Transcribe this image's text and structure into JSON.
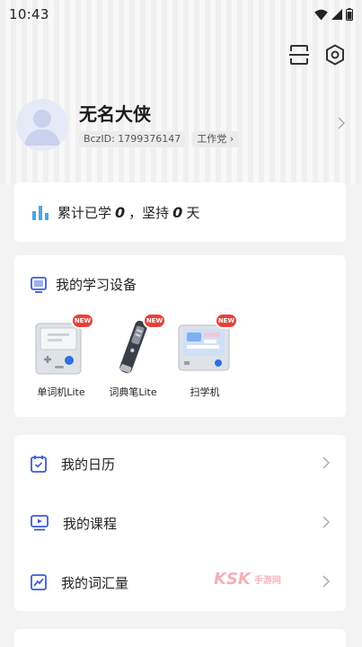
{
  "status_bar": {
    "time": "10:43"
  },
  "profile": {
    "name": "无名大侠",
    "bczid": "BczID: 1799376147",
    "tag": "工作党"
  },
  "stats": {
    "prefix": "累计已学",
    "learned": "0",
    "separator": "，坚持",
    "days": "0",
    "suffix": "天"
  },
  "devices": {
    "title": "我的学习设备",
    "badge": "NEW",
    "items": [
      {
        "label": "单词机Lite",
        "icon": "word-machine-icon"
      },
      {
        "label": "词典笔Lite",
        "icon": "dictionary-pen-icon"
      },
      {
        "label": "扫学机",
        "icon": "scan-learn-machine-icon"
      }
    ]
  },
  "menu": {
    "items": [
      {
        "label": "我的日历",
        "icon": "calendar-icon"
      },
      {
        "label": "我的课程",
        "icon": "course-icon"
      },
      {
        "label": "我的词汇量",
        "icon": "vocabulary-icon"
      }
    ]
  },
  "watermark": {
    "brand": "KSK",
    "text": "手游网"
  },
  "colors": {
    "accent": "#3a5bd9",
    "background": "#f3f3f3",
    "badge": "#e8413a"
  }
}
